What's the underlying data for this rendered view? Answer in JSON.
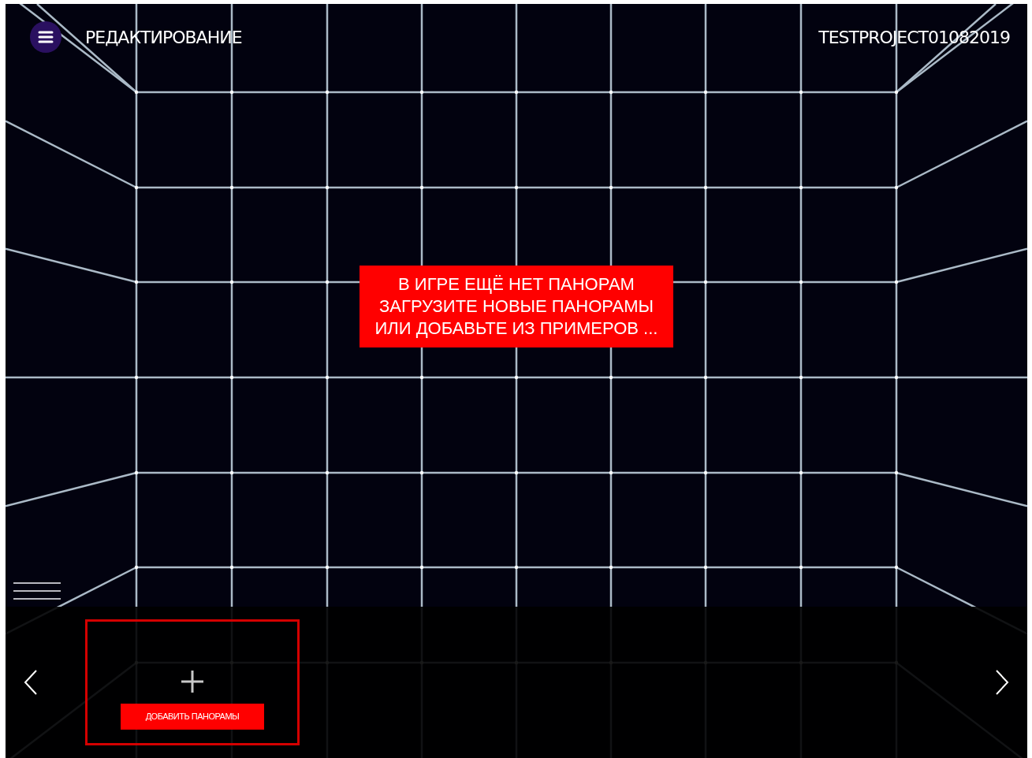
{
  "header": {
    "title": "РЕДАКТИРОВАНИЕ",
    "project": "TESTPROJECT01082019"
  },
  "message": [
    "В ИГРЕ ЕЩЁ НЕТ ПАНОРАМ",
    "ЗАГРУЗИТЕ НОВЫЕ ПАНОРАМЫ",
    "ИЛИ ДОБАВЬТЕ ИЗ ПРИМЕРОВ ..."
  ],
  "panorama_strip": {
    "add_button": "ДОБАВИТЬ ПАНОРАМЫ"
  }
}
